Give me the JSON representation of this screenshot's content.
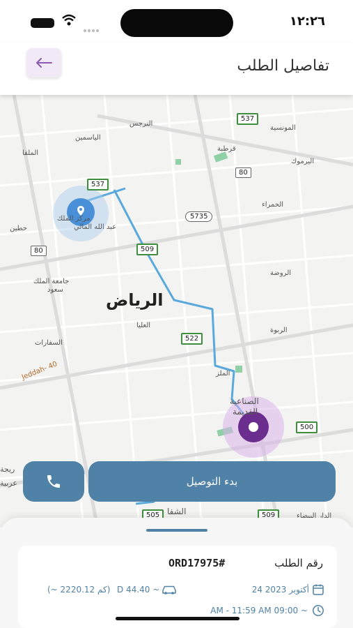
{
  "status_bar": {
    "time": "١٢:٢٦"
  },
  "header": {
    "title": "تفاصيل الطلب",
    "back_icon": "arrow-left-icon"
  },
  "map": {
    "city_label": "الرياض",
    "places": {
      "narjis": "النرجس",
      "yasmin": "الياسمين",
      "malqa": "الملقا",
      "qurtuba": "قرطبة",
      "monsiya": "المونسية",
      "yarmuk": "اليرموك",
      "hamra": "الحمراء",
      "markaz1": "مركز الملك",
      "markaz2": "عبد الله المالي",
      "hittin": "حطين",
      "univ1": "جامعة الملك",
      "univ2": "سعود",
      "rawdah": "الروضة",
      "rabwa": "الربوة",
      "olaya": "العليا",
      "sifarat": "السفارات",
      "malaz": "الملز",
      "sinaiya1": "الصناعية",
      "sinaiya2": "القديمة",
      "shifa": "الشفا",
      "left_edge1": "ريجة",
      "left_edge2": "عربية",
      "bottom_right": "الدار البيضاء"
    },
    "road_jeddah": "Jeddah- 40",
    "shields": {
      "s537_top": "537",
      "s80_right": "80",
      "s537_left": "537",
      "s5735": "5735",
      "s80_left": "80",
      "s509": "509",
      "s522": "522",
      "s500": "500",
      "s505": "505",
      "s509_bottom": "509"
    },
    "colors": {
      "route": "#5aa9dd",
      "pickup": "#4a90d9",
      "dropoff": "#6b2d8e"
    }
  },
  "actions": {
    "call_icon": "phone-icon",
    "start_label": "بدء التوصيل"
  },
  "order": {
    "label": "رقم الطلب",
    "number": "ORD17975#",
    "date": "24 أكتوبر 2023",
    "price": "D 44.40 ~",
    "distance": "(~ 2220.12 كم)",
    "time_range": "AM - 11:59 AM 09:00 ~"
  }
}
